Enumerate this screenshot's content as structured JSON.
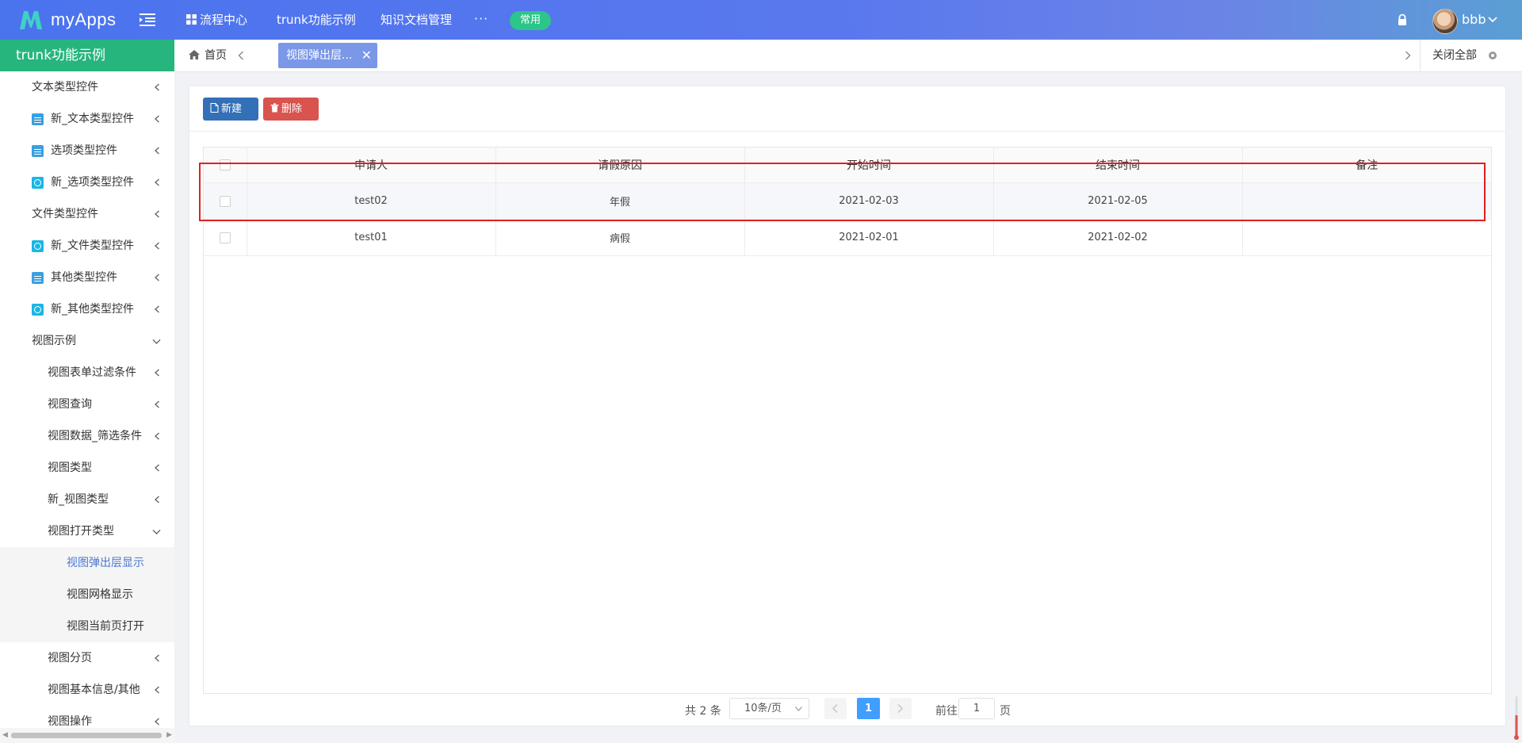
{
  "app": {
    "name": "myApps",
    "brand_color": "#4a73ee"
  },
  "topnav": {
    "items": [
      "流程中心",
      "trunk功能示例",
      "知识文档管理"
    ],
    "more": "···",
    "pill": "常用",
    "username": "bbb"
  },
  "sidebar": {
    "title": "trunk功能示例",
    "items": [
      {
        "label": "文本类型控件",
        "icon": "",
        "state": "collapsed"
      },
      {
        "label": "新_文本类型控件",
        "icon": "document-icon",
        "state": "collapsed"
      },
      {
        "label": "选项类型控件",
        "icon": "document-icon",
        "state": "collapsed"
      },
      {
        "label": "新_选项类型控件",
        "icon": "form-icon",
        "state": "collapsed"
      },
      {
        "label": "文件类型控件",
        "icon": "",
        "state": "collapsed"
      },
      {
        "label": "新_文件类型控件",
        "icon": "form-icon",
        "state": "collapsed"
      },
      {
        "label": "其他类型控件",
        "icon": "document-icon",
        "state": "collapsed"
      },
      {
        "label": "新_其他类型控件",
        "icon": "form-icon",
        "state": "collapsed"
      },
      {
        "label": "视图示例",
        "icon": "",
        "state": "expanded"
      },
      {
        "label": "视图表单过滤条件",
        "state": "collapsed"
      },
      {
        "label": "视图查询",
        "state": "collapsed"
      },
      {
        "label": "视图数据_筛选条件",
        "state": "collapsed"
      },
      {
        "label": "视图类型",
        "state": "collapsed"
      },
      {
        "label": "新_视图类型",
        "state": "collapsed"
      },
      {
        "label": "视图打开类型",
        "state": "expanded"
      },
      {
        "label": "视图弹出层显示",
        "state": "active"
      },
      {
        "label": "视图网格显示",
        "state": ""
      },
      {
        "label": "视图当前页打开",
        "state": ""
      },
      {
        "label": "视图分页",
        "state": "collapsed"
      },
      {
        "label": "视图基本信息/其他",
        "state": "collapsed"
      },
      {
        "label": "视图操作",
        "state": "collapsed"
      }
    ]
  },
  "tabs": {
    "home": "首页",
    "active": "视图弹出层...",
    "close_all": "关闭全部"
  },
  "toolbar": {
    "new_label": "新建",
    "delete_label": "删除"
  },
  "table": {
    "columns": [
      "申请人",
      "请假原因",
      "开始时间",
      "结束时间",
      "备注"
    ],
    "rows": [
      {
        "applicant": "test02",
        "reason": "年假",
        "start": "2021-02-03",
        "end": "2021-02-05",
        "note": "",
        "highlighted": true
      },
      {
        "applicant": "test01",
        "reason": "病假",
        "start": "2021-02-01",
        "end": "2021-02-02",
        "note": "",
        "highlighted": false
      }
    ]
  },
  "pagination": {
    "total": "共 2 条",
    "page_size": "10条/页",
    "current_page": "1",
    "goto_label": "前往",
    "goto_value": "1",
    "page_label": "页"
  }
}
